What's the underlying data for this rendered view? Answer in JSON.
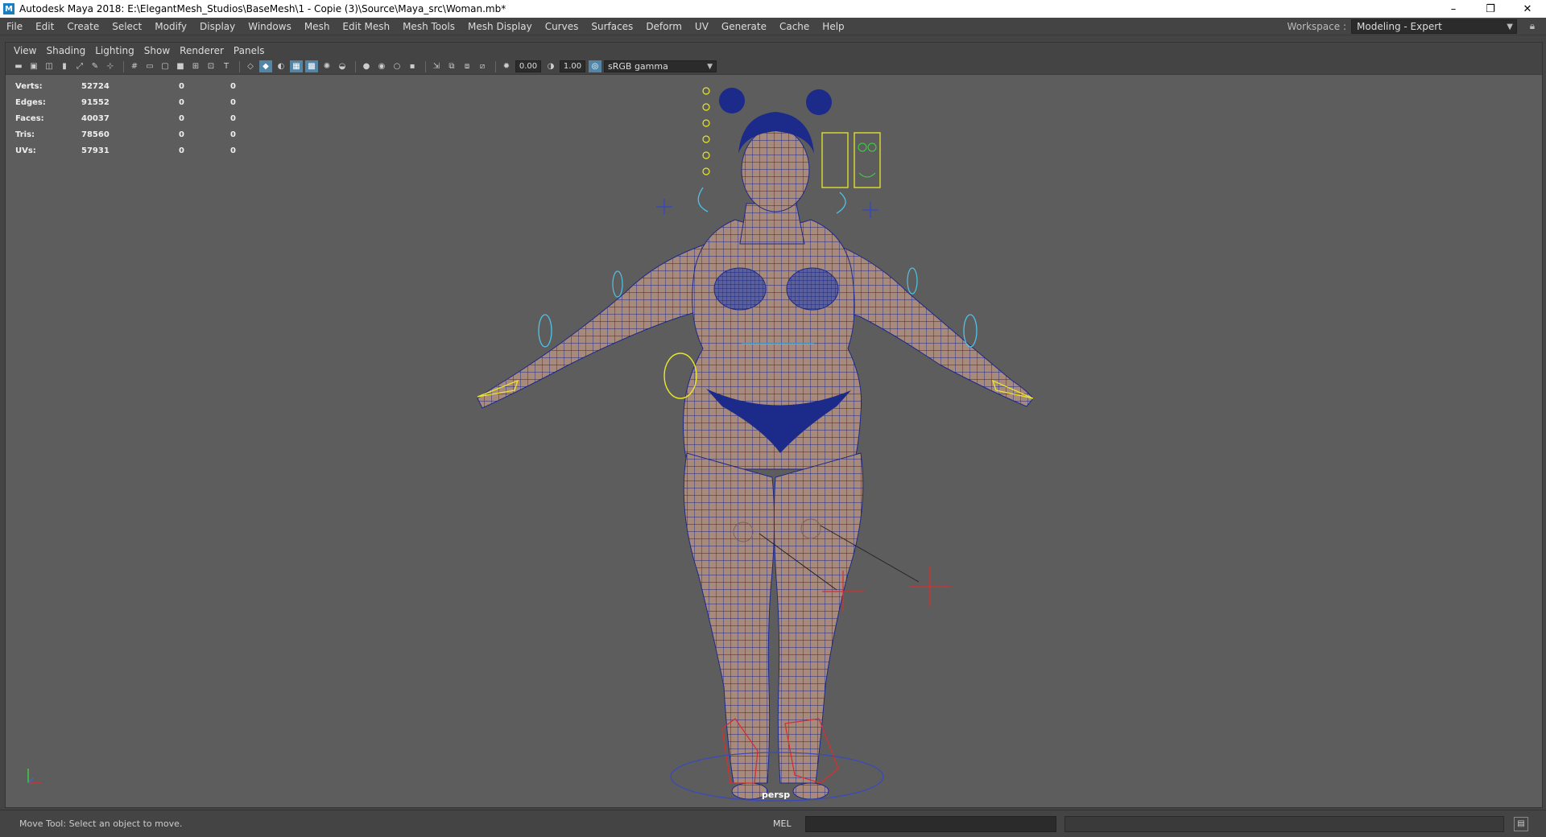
{
  "window": {
    "title": "Autodesk Maya 2018: E:\\ElegantMesh_Studios\\BaseMesh\\1 - Copie (3)\\Source\\Maya_src\\Woman.mb*",
    "minimize": "–",
    "restore": "❐",
    "close": "✕"
  },
  "menu": [
    "File",
    "Edit",
    "Create",
    "Select",
    "Modify",
    "Display",
    "Windows",
    "Mesh",
    "Edit Mesh",
    "Mesh Tools",
    "Mesh Display",
    "Curves",
    "Surfaces",
    "Deform",
    "UV",
    "Generate",
    "Cache",
    "Help"
  ],
  "workspace": {
    "label": "Workspace :",
    "value": "Modeling - Expert"
  },
  "panel_menu": [
    "View",
    "Shading",
    "Lighting",
    "Show",
    "Renderer",
    "Panels"
  ],
  "toolbar": {
    "exposure": "0.00",
    "gamma": "1.00",
    "color_space": "sRGB gamma"
  },
  "hud": [
    {
      "label": "Verts:",
      "v1": "52724",
      "v2": "0",
      "v3": "0"
    },
    {
      "label": "Edges:",
      "v1": "91552",
      "v2": "0",
      "v3": "0"
    },
    {
      "label": "Faces:",
      "v1": "40037",
      "v2": "0",
      "v3": "0"
    },
    {
      "label": "Tris:",
      "v1": "78560",
      "v2": "0",
      "v3": "0"
    },
    {
      "label": "UVs:",
      "v1": "57931",
      "v2": "0",
      "v3": "0"
    }
  ],
  "camera_label": "persp",
  "status": {
    "help": "Move Tool: Select an object to move.",
    "mel": "MEL"
  },
  "colors": {
    "viewport": "#5d5d5d",
    "wire": "#1c2a8a",
    "skin": "#a88a7c",
    "rig_yellow": "#e8e82a",
    "rig_cyan": "#4fc3e8",
    "locator_red": "#d43030",
    "active_icon": "#5285a6"
  }
}
